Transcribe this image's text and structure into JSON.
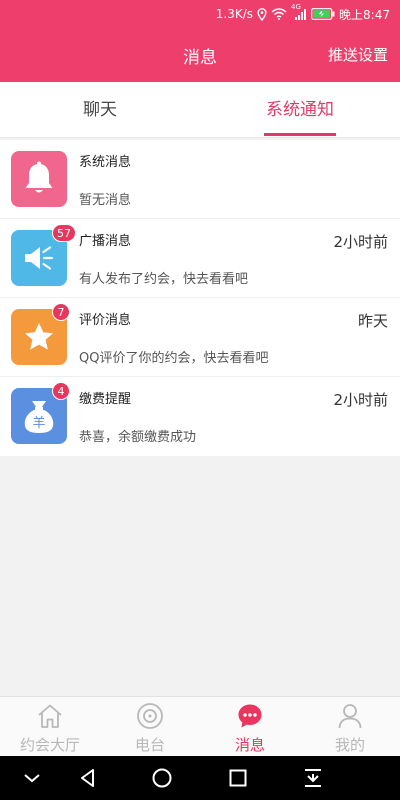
{
  "status_bar": {
    "speed": "1.3K/s",
    "network": "4G",
    "time": "晚上8:47"
  },
  "header": {
    "title": "消息",
    "push_settings": "推送设置"
  },
  "tabs": [
    {
      "label": "聊天",
      "active": false
    },
    {
      "label": "系统通知",
      "active": true
    }
  ],
  "messages": [
    {
      "icon": "bell-icon",
      "color": "#f0668c",
      "name": "系统消息",
      "time": "",
      "preview": "暂无消息",
      "badge": ""
    },
    {
      "icon": "speaker-icon",
      "color": "#4fb8e6",
      "name": "广播消息",
      "time": "2小时前",
      "preview": "有人发布了约会，快去看看吧",
      "badge": "57"
    },
    {
      "icon": "star-icon",
      "color": "#f59a3c",
      "name": "评价消息",
      "time": "昨天",
      "preview": "QQ评价了你的约会，快去看看吧",
      "badge": "7"
    },
    {
      "icon": "money-bag-icon",
      "color": "#5b8fe0",
      "name": "缴费提醒",
      "time": "2小时前",
      "preview": "恭喜，余额缴费成功",
      "badge": "4"
    }
  ],
  "money_symbol": "羊",
  "bottom_nav": [
    {
      "icon": "home-icon",
      "label": "约会大厅",
      "active": false
    },
    {
      "icon": "radio-icon",
      "label": "电台",
      "active": false
    },
    {
      "icon": "chat-icon",
      "label": "消息",
      "active": true
    },
    {
      "icon": "user-icon",
      "label": "我的",
      "active": false
    }
  ],
  "colors": {
    "primary": "#ee3e6c",
    "active_tab": "#e03a68",
    "badge": "#e8365f",
    "inactive_nav": "#b8b8b8"
  }
}
